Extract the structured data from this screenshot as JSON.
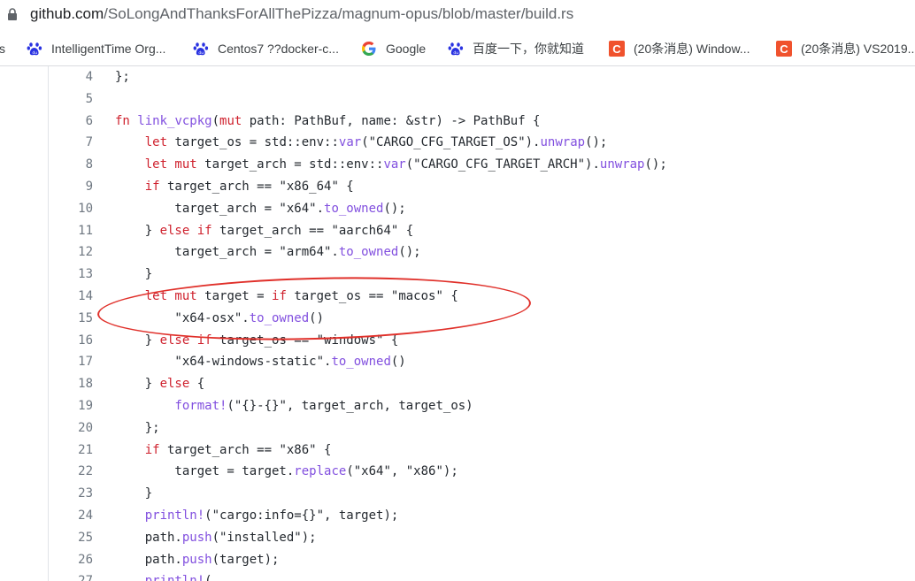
{
  "address_bar": {
    "url_host": "github.com",
    "url_path": "/SoLongAndThanksForAllThePizza/magnum-opus/blob/master/build.rs",
    "lock_icon": "lock-icon"
  },
  "bookmarks": [
    {
      "label": "s",
      "icon": "none"
    },
    {
      "label": "IntelligentTime Org...",
      "icon": "baidu-paw-icon"
    },
    {
      "label": "Centos7 ??docker-c...",
      "icon": "baidu-paw-icon"
    },
    {
      "label": "Google",
      "icon": "google-g-icon"
    },
    {
      "label": "百度一下，你就知道",
      "icon": "baidu-paw-icon"
    },
    {
      "label": "(20条消息) Window...",
      "icon": "csdn-c-icon",
      "icon_text": "C"
    },
    {
      "label": "(20条消息) VS2019...",
      "icon": "csdn-c-icon",
      "icon_text": "C"
    }
  ],
  "code": {
    "lines": [
      {
        "n": "4",
        "tokens": [
          {
            "t": "};",
            "c": ""
          }
        ]
      },
      {
        "n": "5",
        "tokens": []
      },
      {
        "n": "6",
        "tokens": [
          {
            "t": "fn ",
            "c": "kw"
          },
          {
            "t": "link_vcpkg",
            "c": "fnname"
          },
          {
            "t": "(",
            "c": ""
          },
          {
            "t": "mut",
            "c": "kw"
          },
          {
            "t": " path: PathBuf, name: &str) -> PathBuf {",
            "c": ""
          }
        ]
      },
      {
        "n": "7",
        "tokens": [
          {
            "t": "    ",
            "c": ""
          },
          {
            "t": "let",
            "c": "kw"
          },
          {
            "t": " target_os = std::env::",
            "c": ""
          },
          {
            "t": "var",
            "c": "fnname"
          },
          {
            "t": "(\"CARGO_CFG_TARGET_OS\").",
            "c": ""
          },
          {
            "t": "unwrap",
            "c": "fnname"
          },
          {
            "t": "();",
            "c": ""
          }
        ]
      },
      {
        "n": "8",
        "tokens": [
          {
            "t": "    ",
            "c": ""
          },
          {
            "t": "let mut",
            "c": "kw"
          },
          {
            "t": " target_arch = std::env::",
            "c": ""
          },
          {
            "t": "var",
            "c": "fnname"
          },
          {
            "t": "(\"CARGO_CFG_TARGET_ARCH\").",
            "c": ""
          },
          {
            "t": "unwrap",
            "c": "fnname"
          },
          {
            "t": "();",
            "c": ""
          }
        ]
      },
      {
        "n": "9",
        "tokens": [
          {
            "t": "    ",
            "c": ""
          },
          {
            "t": "if",
            "c": "kw"
          },
          {
            "t": " target_arch == \"x86_64\" {",
            "c": ""
          }
        ]
      },
      {
        "n": "10",
        "tokens": [
          {
            "t": "        target_arch = \"x64\".",
            "c": ""
          },
          {
            "t": "to_owned",
            "c": "fnname"
          },
          {
            "t": "();",
            "c": ""
          }
        ]
      },
      {
        "n": "11",
        "tokens": [
          {
            "t": "    } ",
            "c": ""
          },
          {
            "t": "else if",
            "c": "kw"
          },
          {
            "t": " target_arch == \"aarch64\" {",
            "c": ""
          }
        ]
      },
      {
        "n": "12",
        "tokens": [
          {
            "t": "        target_arch = \"arm64\".",
            "c": ""
          },
          {
            "t": "to_owned",
            "c": "fnname"
          },
          {
            "t": "();",
            "c": ""
          }
        ]
      },
      {
        "n": "13",
        "tokens": [
          {
            "t": "    }",
            "c": ""
          }
        ]
      },
      {
        "n": "14",
        "tokens": [
          {
            "t": "    ",
            "c": ""
          },
          {
            "t": "let mut",
            "c": "kw"
          },
          {
            "t": " target = ",
            "c": ""
          },
          {
            "t": "if",
            "c": "kw"
          },
          {
            "t": " target_os == \"macos\" {",
            "c": ""
          }
        ]
      },
      {
        "n": "15",
        "tokens": [
          {
            "t": "        \"x64-osx\".",
            "c": ""
          },
          {
            "t": "to_owned",
            "c": "fnname"
          },
          {
            "t": "()",
            "c": ""
          }
        ]
      },
      {
        "n": "16",
        "tokens": [
          {
            "t": "    } ",
            "c": ""
          },
          {
            "t": "else if",
            "c": "kw"
          },
          {
            "t": " target_os == \"windows\" {",
            "c": ""
          }
        ]
      },
      {
        "n": "17",
        "tokens": [
          {
            "t": "        \"x64-windows-static\".",
            "c": ""
          },
          {
            "t": "to_owned",
            "c": "fnname"
          },
          {
            "t": "()",
            "c": ""
          }
        ]
      },
      {
        "n": "18",
        "tokens": [
          {
            "t": "    } ",
            "c": ""
          },
          {
            "t": "else",
            "c": "kw"
          },
          {
            "t": " {",
            "c": ""
          }
        ]
      },
      {
        "n": "19",
        "tokens": [
          {
            "t": "        ",
            "c": ""
          },
          {
            "t": "format!",
            "c": "mac"
          },
          {
            "t": "(\"{}-{}\", target_arch, target_os)",
            "c": ""
          }
        ]
      },
      {
        "n": "20",
        "tokens": [
          {
            "t": "    };",
            "c": ""
          }
        ]
      },
      {
        "n": "21",
        "tokens": [
          {
            "t": "    ",
            "c": ""
          },
          {
            "t": "if",
            "c": "kw"
          },
          {
            "t": " target_arch == \"x86\" {",
            "c": ""
          }
        ]
      },
      {
        "n": "22",
        "tokens": [
          {
            "t": "        target = target.",
            "c": ""
          },
          {
            "t": "replace",
            "c": "fnname"
          },
          {
            "t": "(\"x64\", \"x86\");",
            "c": ""
          }
        ]
      },
      {
        "n": "23",
        "tokens": [
          {
            "t": "    }",
            "c": ""
          }
        ]
      },
      {
        "n": "24",
        "tokens": [
          {
            "t": "    ",
            "c": ""
          },
          {
            "t": "println!",
            "c": "mac"
          },
          {
            "t": "(\"cargo:info={}\", target);",
            "c": ""
          }
        ]
      },
      {
        "n": "25",
        "tokens": [
          {
            "t": "    path.",
            "c": ""
          },
          {
            "t": "push",
            "c": "fnname"
          },
          {
            "t": "(\"installed\");",
            "c": ""
          }
        ]
      },
      {
        "n": "26",
        "tokens": [
          {
            "t": "    path.",
            "c": ""
          },
          {
            "t": "push",
            "c": "fnname"
          },
          {
            "t": "(target);",
            "c": ""
          }
        ]
      },
      {
        "n": "27",
        "tokens": [
          {
            "t": "    ",
            "c": ""
          },
          {
            "t": "println!",
            "c": "mac"
          },
          {
            "t": "(",
            "c": ""
          }
        ]
      }
    ]
  },
  "colors": {
    "keyword": "#cf222e",
    "function": "#8250df",
    "annotation_circle": "#e0302a"
  }
}
